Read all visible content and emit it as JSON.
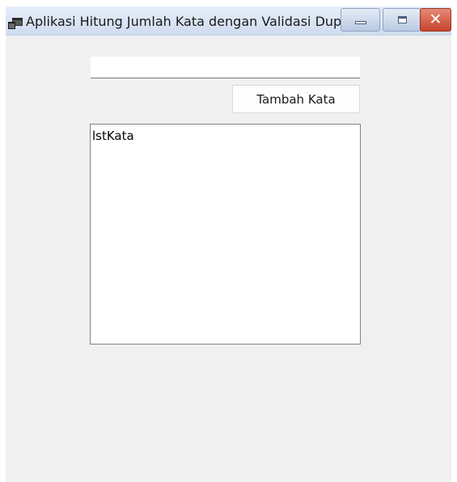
{
  "window": {
    "title": "Aplikasi Hitung Jumlah Kata dengan Validasi Dupl...",
    "icon": "app-window-icon",
    "controls": {
      "minimize_icon": "minimize-icon",
      "maximize_icon": "maximize-icon",
      "close_icon": "close-icon",
      "close_glyph": "✕",
      "close_color": "#c8442c"
    }
  },
  "form": {
    "word_input": {
      "value": "",
      "placeholder": ""
    },
    "add_button_label": "Tambah Kata",
    "word_list": {
      "items": [
        "lstKata"
      ]
    }
  }
}
